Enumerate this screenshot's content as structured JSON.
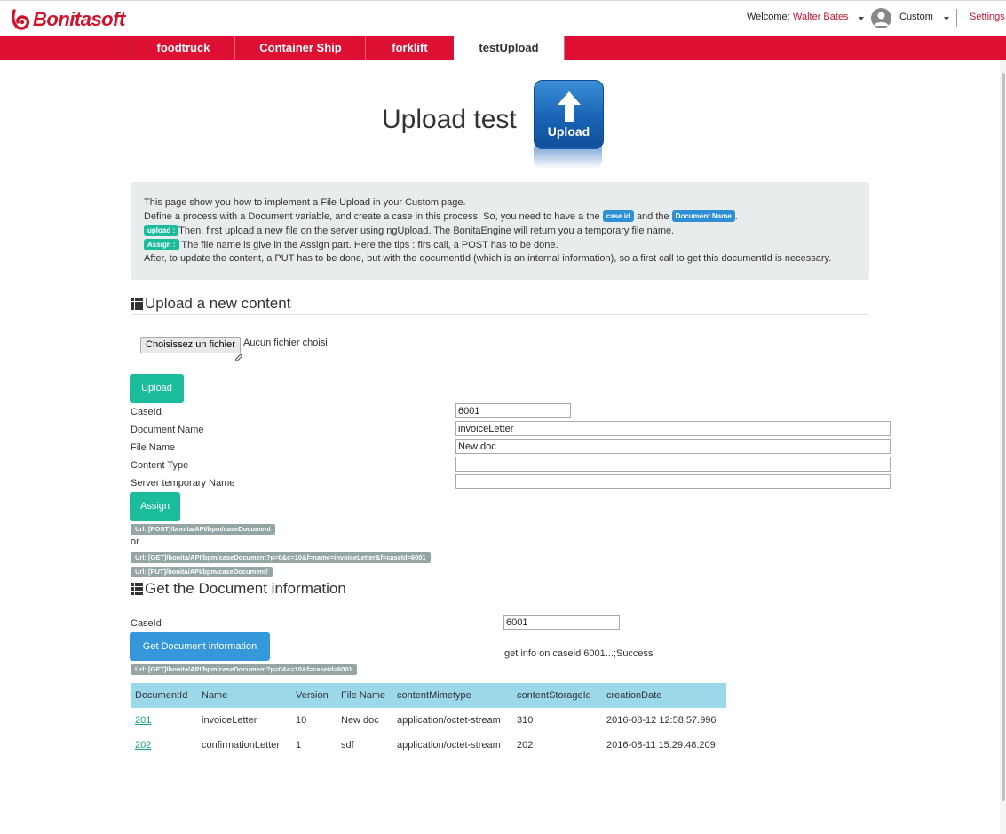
{
  "header": {
    "brand": "Bonitasoft",
    "welcome_label": "Welcome:",
    "user_name": "Walter Bates",
    "profile": "Custom",
    "settings": "Settings"
  },
  "tabs": [
    {
      "label": "foodtruck",
      "active": false
    },
    {
      "label": "Container Ship",
      "active": false
    },
    {
      "label": "forklift",
      "active": false
    },
    {
      "label": "testUpload",
      "active": true
    }
  ],
  "page": {
    "title": "Upload test",
    "logo_text": "Upload"
  },
  "info": {
    "line1": "This page show you how to implement a File Upload in your Custom page.",
    "line2_a": "Define a process with a Document variable, and create a case in this process. So, you need to have a the",
    "line2_tag1": "case id",
    "line2_b": "and the",
    "line2_tag2": "Document Name",
    "line2_c": ".",
    "line3_tag": "upload :",
    "line3": "Then, first upload a new file on the server using ngUpload. The BonitaEngine will return you a temporary file name.",
    "line4_tag": "Assign :",
    "line4": "The file name is give in the Assign part. Here the tips : firs call, a POST has to be done.",
    "line5": "After, to update the content, a PUT has to be done, but with the documentId (which is an internal information), so a first call to get this documentId is necessary."
  },
  "upload_section": {
    "title": "Upload a new content",
    "file_button": "Choisissez un fichier",
    "file_status": "Aucun fichier choisi",
    "upload_button": "Upload",
    "fields": [
      {
        "label": "CaseId",
        "value": "6001"
      },
      {
        "label": "Document Name",
        "value": "invoiceLetter"
      },
      {
        "label": "File Name",
        "value": "New doc"
      },
      {
        "label": "Content Type",
        "value": ""
      },
      {
        "label": "Server temporary Name",
        "value": ""
      }
    ],
    "assign_button": "Assign",
    "url_post": "Url: [POST]/bonita/API/bpm/caseDocument",
    "or_label": "or",
    "url_get": "Url: [GET]/bonita/API/bpm/caseDocument?p=0&c=10&f=name=invoiceLetter&f=caseId=6001",
    "url_put": "Url: [PUT]/bonita/API/bpm/caseDocument/"
  },
  "info_section": {
    "title": "Get the Document information",
    "caseid_label": "CaseId",
    "caseid_value": "6001",
    "get_button": "Get Document information",
    "status": "get info on caseid 6001...;Success",
    "url_get": "Url: [GET]/bonita/API/bpm/caseDocument?p=0&c=10&f=caseId=6001"
  },
  "table": {
    "columns": [
      "DocumentId",
      "Name",
      "Version",
      "File Name",
      "contentMimetype",
      "contentStorageId",
      "creationDate"
    ],
    "rows": [
      [
        "201",
        "invoiceLetter",
        "10",
        "New doc",
        "application/octet-stream",
        "310",
        "2016-08-12 12:58:57.996"
      ],
      [
        "202",
        "confirmationLetter",
        "1",
        "sdf",
        "application/octet-stream",
        "202",
        "2016-08-11 15:29:48.209"
      ]
    ]
  },
  "colors": {
    "brand_red": "#dd1033",
    "green_button": "#1abc9c",
    "blue_button": "#3498db",
    "table_header": "#9bd8ea",
    "url_tag": "#95a5a6"
  }
}
